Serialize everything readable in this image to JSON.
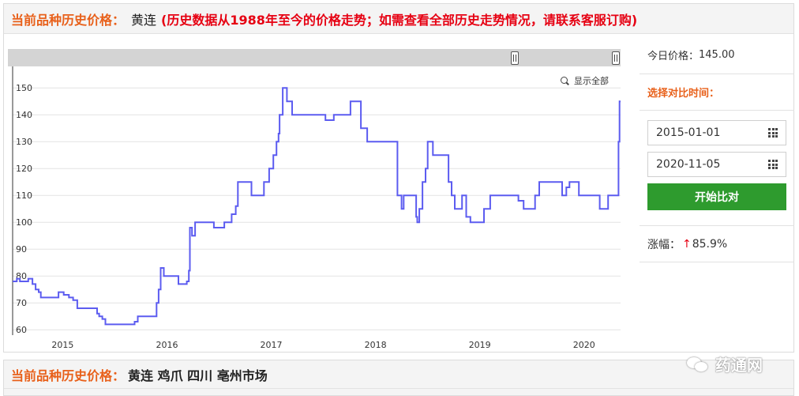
{
  "header": {
    "label": "当前品种历史价格：",
    "name": "黄连",
    "note": "(历史数据从1988年至今的价格走势；如需查看全部历史走势情况，请联系客服订购)"
  },
  "chart_controls": {
    "show_all": "显示全部"
  },
  "side": {
    "price_label": "今日价格：",
    "price_value": "145.00",
    "compare_title": "选择对比时间：",
    "date_from": "2015-01-01",
    "date_to": "2020-11-05",
    "button": "开始比对",
    "rise_label": "涨幅：",
    "rise_arrow": "↑",
    "rise_value": "85.9%"
  },
  "bottom": {
    "label": "当前品种历史价格：",
    "name": "黄连 鸡爪 四川 亳州市场"
  },
  "watermark": {
    "text": "药通网"
  },
  "colors": {
    "line": "#5c5cf0",
    "accent": "#e8601a",
    "note": "#e60012",
    "button": "#2e9b2e"
  },
  "chart_data": {
    "type": "line",
    "title": "",
    "xlabel": "",
    "ylabel": "",
    "ylim": [
      58,
      158
    ],
    "xlim": [
      2014.52,
      2020.35
    ],
    "yticks": [
      60,
      70,
      80,
      90,
      100,
      110,
      120,
      130,
      140,
      150
    ],
    "xticks": [
      {
        "value": 2015,
        "label": "2015"
      },
      {
        "value": 2016,
        "label": "2016"
      },
      {
        "value": 2017,
        "label": "2017"
      },
      {
        "value": 2018,
        "label": "2018"
      },
      {
        "value": 2019,
        "label": "2019"
      },
      {
        "value": 2020,
        "label": "2020"
      }
    ],
    "grid": true,
    "series": [
      {
        "name": "",
        "step": true,
        "points": [
          [
            2014.52,
            78
          ],
          [
            2014.56,
            79
          ],
          [
            2014.59,
            78
          ],
          [
            2014.67,
            79
          ],
          [
            2014.71,
            77
          ],
          [
            2014.74,
            75
          ],
          [
            2014.77,
            74
          ],
          [
            2014.79,
            72
          ],
          [
            2014.96,
            74
          ],
          [
            2015.01,
            73
          ],
          [
            2015.06,
            72
          ],
          [
            2015.1,
            71
          ],
          [
            2015.14,
            68
          ],
          [
            2015.33,
            66
          ],
          [
            2015.35,
            65
          ],
          [
            2015.38,
            64
          ],
          [
            2015.41,
            62
          ],
          [
            2015.69,
            63
          ],
          [
            2015.72,
            65
          ],
          [
            2015.9,
            70
          ],
          [
            2015.92,
            75
          ],
          [
            2015.94,
            83
          ],
          [
            2015.97,
            80
          ],
          [
            2016.11,
            77
          ],
          [
            2016.19,
            78
          ],
          [
            2016.21,
            82
          ],
          [
            2016.22,
            98
          ],
          [
            2016.24,
            95
          ],
          [
            2016.27,
            100
          ],
          [
            2016.45,
            98
          ],
          [
            2016.55,
            100
          ],
          [
            2016.62,
            103
          ],
          [
            2016.66,
            106
          ],
          [
            2016.68,
            115
          ],
          [
            2016.81,
            110
          ],
          [
            2016.93,
            115
          ],
          [
            2016.98,
            120
          ],
          [
            2017.02,
            125
          ],
          [
            2017.05,
            130
          ],
          [
            2017.07,
            133
          ],
          [
            2017.08,
            140
          ],
          [
            2017.11,
            150
          ],
          [
            2017.15,
            145
          ],
          [
            2017.2,
            140
          ],
          [
            2017.52,
            138
          ],
          [
            2017.6,
            140
          ],
          [
            2017.76,
            145
          ],
          [
            2017.86,
            135
          ],
          [
            2017.92,
            130
          ],
          [
            2018.21,
            110
          ],
          [
            2018.25,
            105
          ],
          [
            2018.27,
            110
          ],
          [
            2018.39,
            102
          ],
          [
            2018.4,
            100
          ],
          [
            2018.42,
            105
          ],
          [
            2018.45,
            115
          ],
          [
            2018.48,
            120
          ],
          [
            2018.5,
            130
          ],
          [
            2018.55,
            125
          ],
          [
            2018.7,
            115
          ],
          [
            2018.73,
            110
          ],
          [
            2018.76,
            105
          ],
          [
            2018.83,
            110
          ],
          [
            2018.87,
            102
          ],
          [
            2018.91,
            100
          ],
          [
            2019.04,
            105
          ],
          [
            2019.1,
            110
          ],
          [
            2019.37,
            108
          ],
          [
            2019.42,
            105
          ],
          [
            2019.53,
            110
          ],
          [
            2019.57,
            115
          ],
          [
            2019.79,
            110
          ],
          [
            2019.83,
            113
          ],
          [
            2019.86,
            115
          ],
          [
            2019.95,
            110
          ],
          [
            2020.15,
            105
          ],
          [
            2020.23,
            110
          ],
          [
            2020.33,
            130
          ],
          [
            2020.34,
            145
          ],
          [
            2020.35,
            145
          ]
        ]
      }
    ]
  }
}
